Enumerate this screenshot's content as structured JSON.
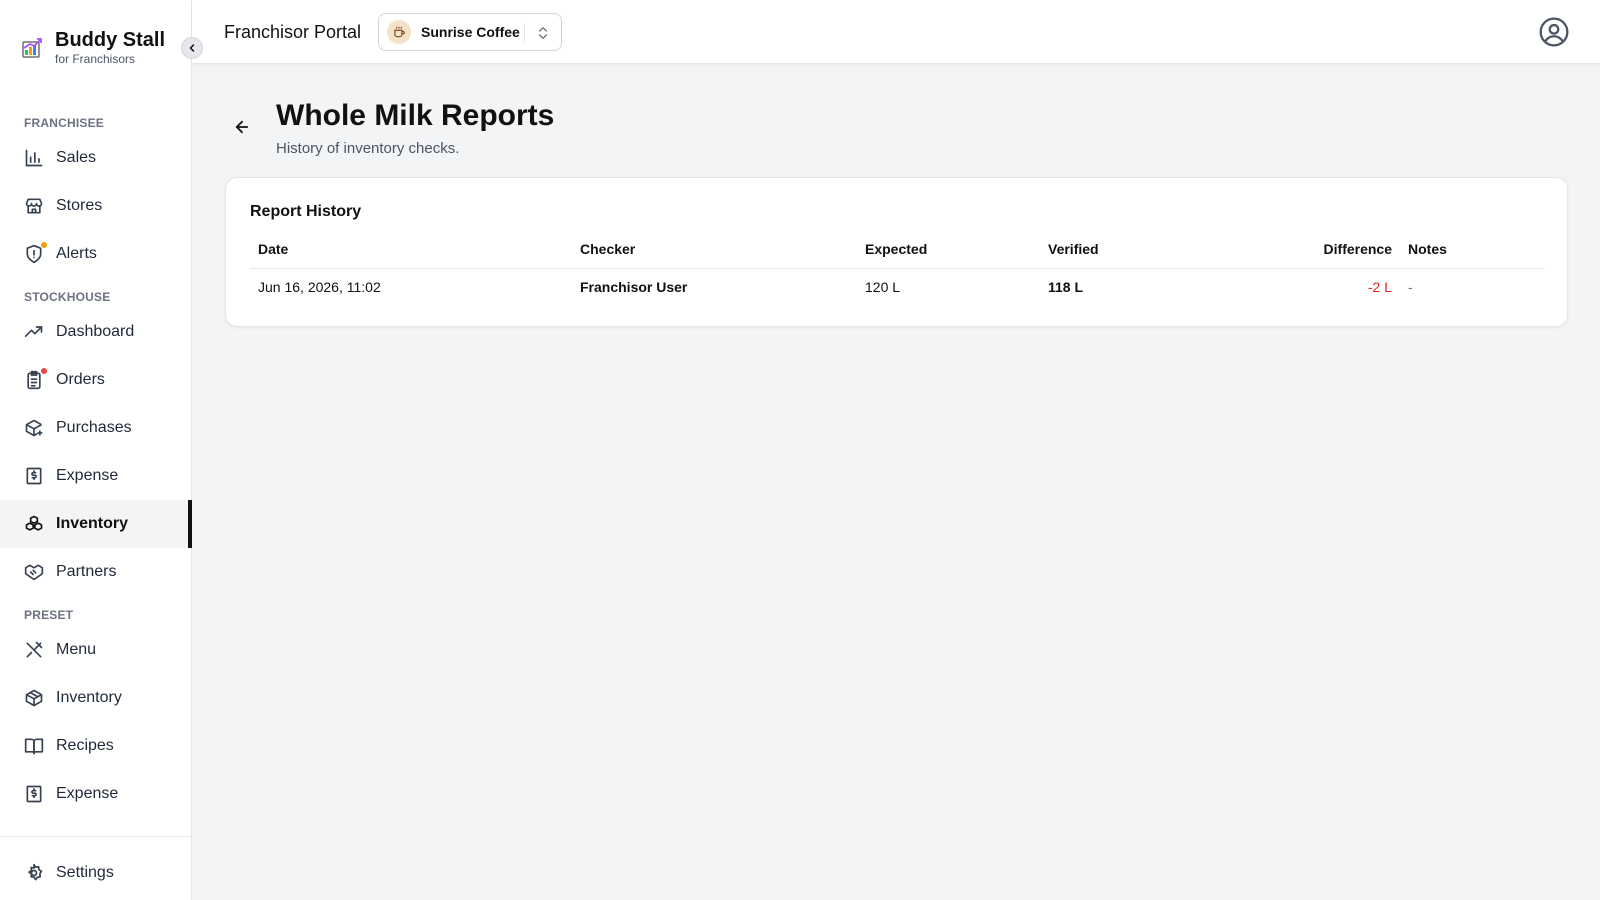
{
  "brand": {
    "title": "Buddy Stall",
    "subtitle": "for Franchisors"
  },
  "sidebar": {
    "sections": [
      {
        "label": "FRANCHISEE",
        "items": [
          {
            "label": "Sales",
            "icon": "bar-chart-icon"
          },
          {
            "label": "Stores",
            "icon": "store-icon"
          },
          {
            "label": "Alerts",
            "icon": "alert-shield-icon",
            "badge_color": "#f59e0b"
          }
        ]
      },
      {
        "label": "STOCKHOUSE",
        "items": [
          {
            "label": "Dashboard",
            "icon": "trending-up-icon"
          },
          {
            "label": "Orders",
            "icon": "clipboard-list-icon",
            "badge_color": "#ef4444"
          },
          {
            "label": "Purchases",
            "icon": "package-plus-icon"
          },
          {
            "label": "Expense",
            "icon": "receipt-dollar-icon"
          },
          {
            "label": "Inventory",
            "icon": "boxes-icon",
            "active": true
          },
          {
            "label": "Partners",
            "icon": "handshake-icon"
          }
        ]
      },
      {
        "label": "PRESET",
        "items": [
          {
            "label": "Menu",
            "icon": "utensils-crossed-icon"
          },
          {
            "label": "Inventory",
            "icon": "package-icon"
          },
          {
            "label": "Recipes",
            "icon": "book-open-icon"
          },
          {
            "label": "Expense",
            "icon": "receipt-dollar-icon"
          }
        ]
      }
    ],
    "settings_label": "Settings"
  },
  "topbar": {
    "portal_title": "Franchisor Portal",
    "store_name": "Sunrise Coffee"
  },
  "page": {
    "title": "Whole Milk Reports",
    "subtitle": "History of inventory checks."
  },
  "report": {
    "title": "Report History",
    "columns": {
      "date": "Date",
      "checker": "Checker",
      "expected": "Expected",
      "verified": "Verified",
      "difference": "Difference",
      "notes": "Notes"
    },
    "rows": [
      {
        "date": "Jun 16, 2026, 11:02",
        "checker": "Franchisor User",
        "expected": "120 L",
        "verified": "118 L",
        "difference": "-2 L",
        "notes": "-"
      }
    ]
  },
  "colors": {
    "accent": "#111111",
    "negative": "#dc2626",
    "alert_dot": "#f59e0b",
    "order_dot": "#ef4444"
  }
}
